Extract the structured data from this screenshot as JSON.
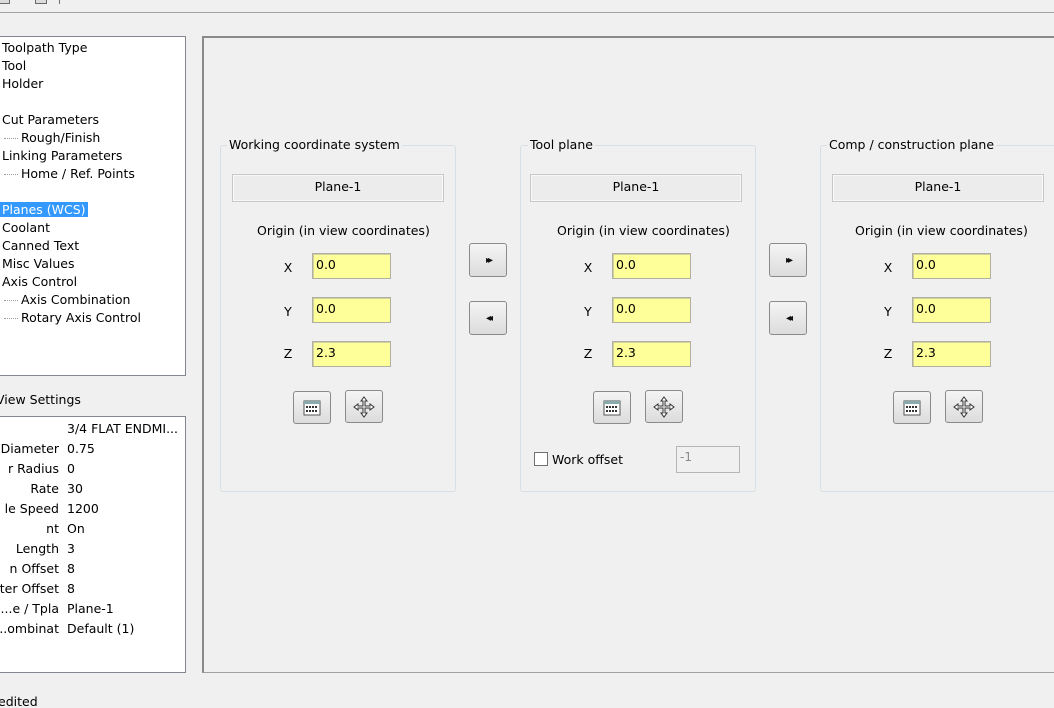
{
  "tree": {
    "items": [
      {
        "label": "Toolpath Type"
      },
      {
        "label": "Tool"
      },
      {
        "label": "Holder"
      },
      {
        "label": "Cut Parameters"
      },
      {
        "label": "Rough/Finish"
      },
      {
        "label": "Linking Parameters"
      },
      {
        "label": "Home / Ref. Points"
      },
      {
        "label": "Planes (WCS)"
      },
      {
        "label": "Coolant"
      },
      {
        "label": "Canned Text"
      },
      {
        "label": "Misc Values"
      },
      {
        "label": "Axis Control"
      },
      {
        "label": "Axis Combination"
      },
      {
        "label": "Rotary Axis Control"
      }
    ]
  },
  "view_settings": {
    "label": "View Settings",
    "rows": [
      {
        "key": "",
        "value": "3/4 FLAT ENDMI..."
      },
      {
        "key": "Diameter",
        "value": "0.75"
      },
      {
        "key": "r Radius",
        "value": "0"
      },
      {
        "key": "Rate",
        "value": "30"
      },
      {
        "key": "le Speed",
        "value": "1200"
      },
      {
        "key": "nt",
        "value": "On"
      },
      {
        "key": "Length",
        "value": "3"
      },
      {
        "key": "n Offset",
        "value": "8"
      },
      {
        "key": "eter Offset",
        "value": "8"
      },
      {
        "key": "e / Tpla...",
        "value": "Plane-1"
      },
      {
        "key": "ombinat...",
        "value": "Default (1)"
      }
    ]
  },
  "status": "edited",
  "groups": {
    "wcs": {
      "title": "Working coordinate system",
      "plane": "Plane-1",
      "origin_label": "Origin (in view coordinates)",
      "x_label": "X",
      "y_label": "Y",
      "z_label": "Z",
      "x": "0.0",
      "y": "0.0",
      "z": "2.3"
    },
    "tool": {
      "title": "Tool plane",
      "plane": "Plane-1",
      "origin_label": "Origin (in view coordinates)",
      "x_label": "X",
      "y_label": "Y",
      "z_label": "Z",
      "x": "0.0",
      "y": "0.0",
      "z": "2.3",
      "work_offset_label": "Work offset",
      "work_offset_value": "-1"
    },
    "comp": {
      "title": "Comp / construction plane",
      "plane": "Plane-1",
      "origin_label": "Origin (in view coordinates)",
      "x_label": "X",
      "y_label": "Y",
      "z_label": "Z",
      "x": "0.0",
      "y": "0.0",
      "z": "2.3"
    }
  },
  "copy_buttons": {
    "forward": "▸▸",
    "back": "◂◂"
  },
  "icons": {
    "calculator": "calculator-icon",
    "move": "move-icon"
  },
  "colors": {
    "selection": "#3399ff",
    "field": "#ffff99"
  }
}
